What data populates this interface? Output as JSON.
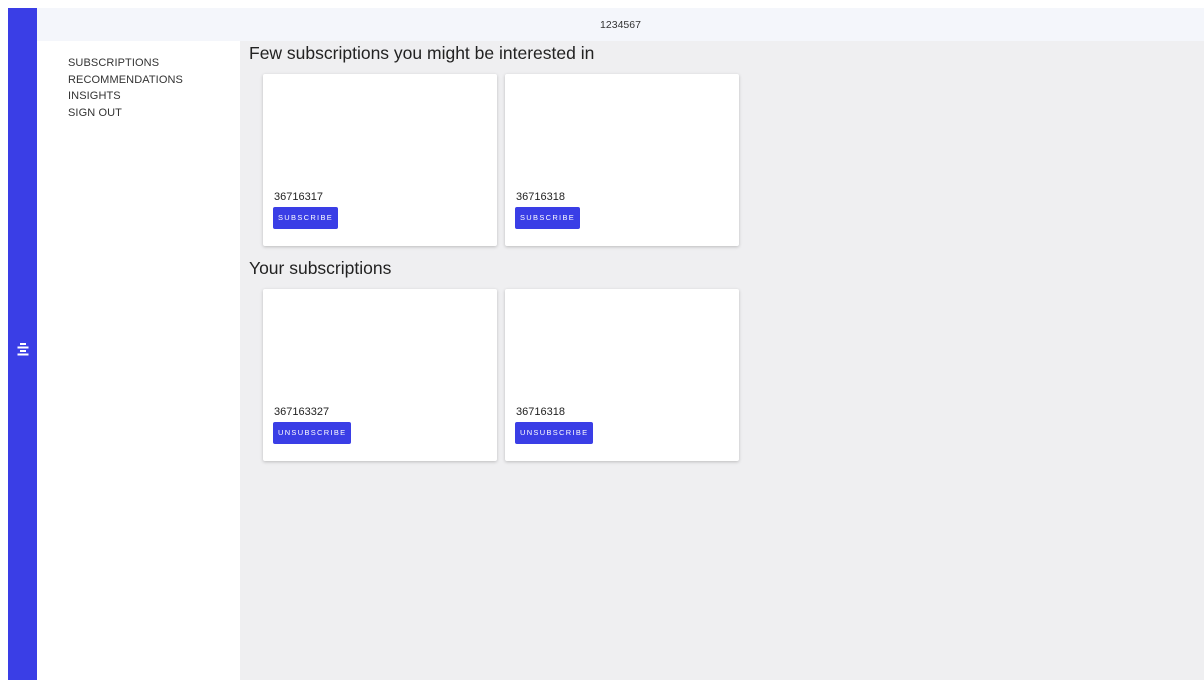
{
  "header": {
    "title": "1234567"
  },
  "sidebar": {
    "toggle_icon": "menu-lines-icon",
    "items": [
      {
        "label": "SUBSCRIPTIONS"
      },
      {
        "label": "RECOMMENDATIONS"
      },
      {
        "label": "INSIGHTS"
      },
      {
        "label": "SIGN OUT"
      }
    ]
  },
  "recommendations": {
    "title": "Few subscriptions you might be interested in",
    "cards": [
      {
        "id": "36716317",
        "button_label": "SUBSCRIBE"
      },
      {
        "id": "36716318",
        "button_label": "SUBSCRIBE"
      }
    ]
  },
  "subscriptions": {
    "title": "Your subscriptions",
    "cards": [
      {
        "id": "367163327",
        "button_label": "UNSUBSCRIBE"
      },
      {
        "id": "36716318",
        "button_label": "UNSUBSCRIBE"
      }
    ]
  },
  "colors": {
    "accent": "#3a3ee6",
    "main_background": "#efeff1",
    "topbar_background": "#f4f6fb"
  }
}
